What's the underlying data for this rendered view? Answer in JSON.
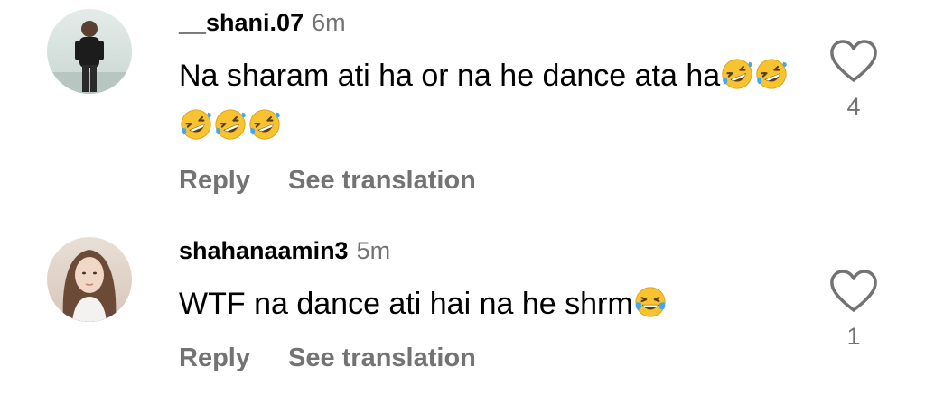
{
  "comments": [
    {
      "username": "__shani.07",
      "time": "6m",
      "text": "Na sharam ati ha or na he dance ata ha",
      "emojis": [
        "rofl",
        "rofl",
        "rofl",
        "rofl",
        "rofl"
      ],
      "reply_label": "Reply",
      "translate_label": "See translation",
      "likes": "4",
      "like_icon": "heart-outline-icon",
      "avatar": "profile-photo"
    },
    {
      "username": "shahanaamin3",
      "time": "5m",
      "text": "WTF na dance ati hai na he shrm",
      "emojis": [
        "joy"
      ],
      "reply_label": "Reply",
      "translate_label": "See translation",
      "likes": "1",
      "like_icon": "heart-outline-icon",
      "avatar": "profile-photo"
    }
  ],
  "colors": {
    "text": "#000000",
    "secondary": "#737373",
    "background": "#ffffff",
    "emoji_face": "#F7C32E",
    "emoji_tear": "#3FA9F5"
  }
}
